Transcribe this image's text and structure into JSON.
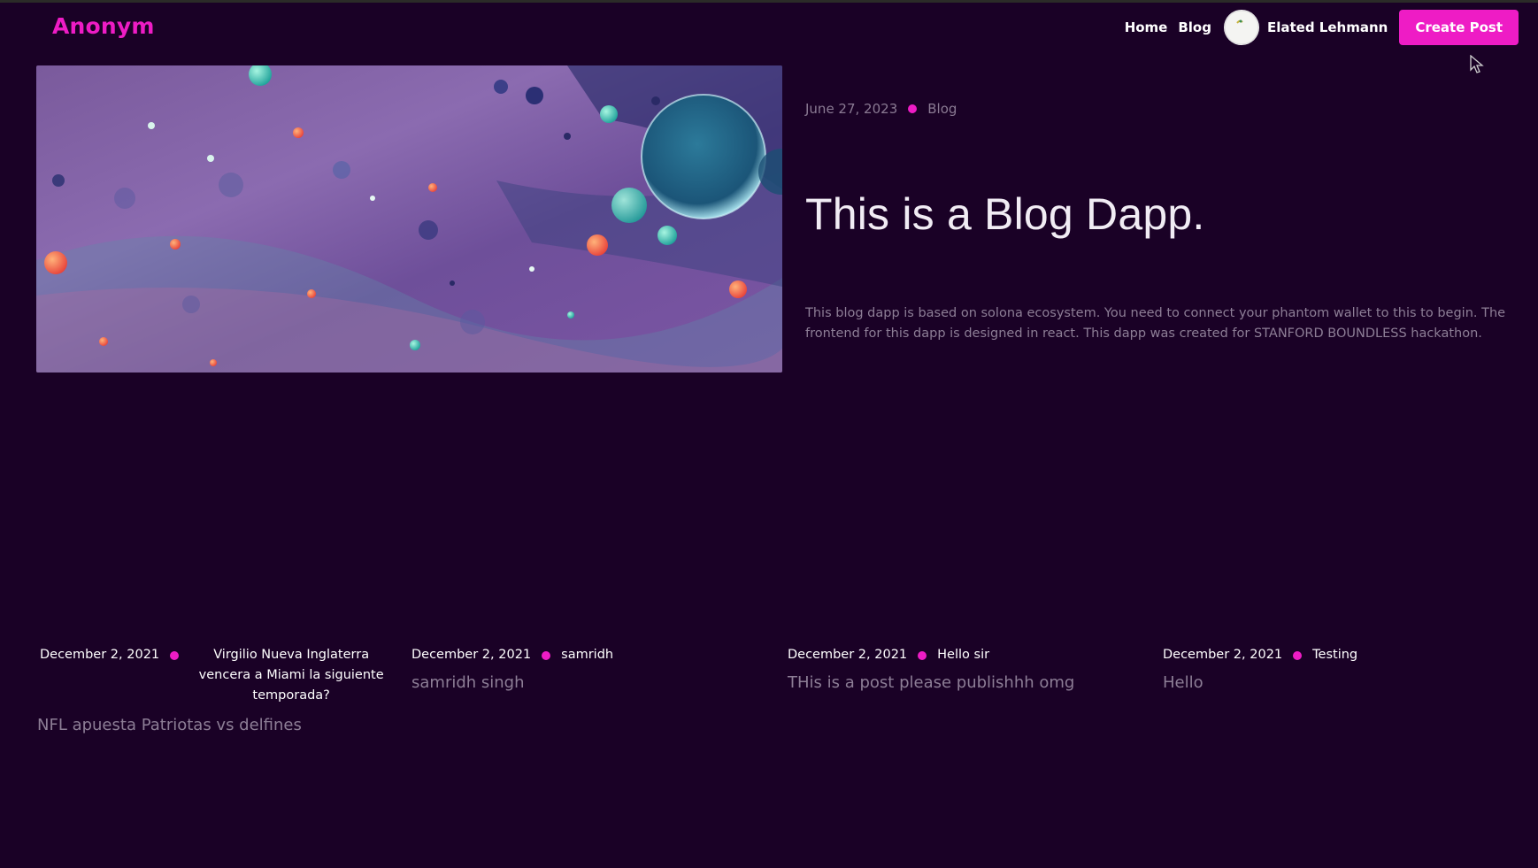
{
  "brand": "Anonym",
  "nav": {
    "home": "Home",
    "blog": "Blog",
    "user_name": "Elated Lehmann",
    "create_post": "Create Post"
  },
  "hero": {
    "date": "June 27, 2023",
    "category": "Blog",
    "title": "This is a Blog Dapp.",
    "description": "This blog dapp is based on solona ecosystem. You need to connect your phantom wallet to this to begin. The frontend for this dapp is designed in react. This dapp was created for STANFORD BOUNDLESS hackathon."
  },
  "posts": [
    {
      "date": "December 2, 2021",
      "category": "Virgilio Nueva Inglaterra vencera a Miami la siguiente temporada?",
      "title": "NFL apuesta Patriotas vs delfines"
    },
    {
      "date": "December 2, 2021",
      "category": "samridh",
      "title": "samridh singh"
    },
    {
      "date": "December 2, 2021",
      "category": "Hello sir",
      "title": "THis is a post please publishhh omg"
    },
    {
      "date": "December 2, 2021",
      "category": "Testing",
      "title": "Hello"
    }
  ],
  "colors": {
    "background": "#1a0126",
    "accent": "#ee1cc5",
    "muted_text": "#8d7e96"
  },
  "icons": {
    "avatar": "avatar-icon",
    "cursor": "mouse-cursor-icon"
  }
}
